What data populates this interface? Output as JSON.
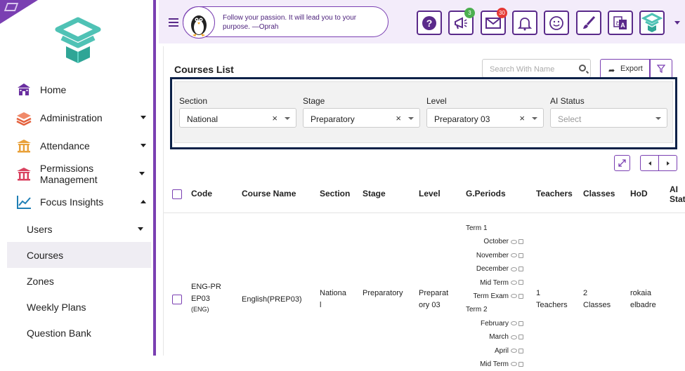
{
  "colors": {
    "accent": "#7a3fb2",
    "topbar": "#f3ecfa",
    "panel_border": "#0b2148",
    "badge_green": "#4caf50",
    "badge_red": "#e53935"
  },
  "sidebar": {
    "items": [
      {
        "label": "Home",
        "icon": "home-icon"
      },
      {
        "label": "Administration",
        "icon": "layers-icon"
      },
      {
        "label": "Attendance",
        "icon": "building-icon"
      },
      {
        "label": "Permissions Management",
        "icon": "building-icon"
      },
      {
        "label": "Focus Insights",
        "icon": "chart-line-icon"
      }
    ],
    "sub_items": [
      {
        "label": "Users"
      },
      {
        "label": "Courses"
      },
      {
        "label": "Zones"
      },
      {
        "label": "Weekly Plans"
      },
      {
        "label": "Question Bank"
      }
    ]
  },
  "topbar": {
    "quote": "Follow your passion. It will lead you to your purpose. —Oprah",
    "icons": [
      "help-icon",
      "megaphone-icon",
      "mail-icon",
      "bell-icon",
      "smiley-icon",
      "brush-icon",
      "translate-icon",
      "profile-logo-icon"
    ],
    "badges": {
      "announcements": "3",
      "messages": "30"
    }
  },
  "main": {
    "title": "Courses List",
    "search_placeholder": "Search With Name",
    "export_label": "Export",
    "filters": [
      {
        "label": "Section",
        "value": "National"
      },
      {
        "label": "Stage",
        "value": "Preparatory"
      },
      {
        "label": "Level",
        "value": "Preparatory 03"
      },
      {
        "label": "AI Status",
        "placeholder": "Select"
      }
    ],
    "table": {
      "headers": [
        "Code",
        "Course Name",
        "Section",
        "Stage",
        "Level",
        "G.Periods",
        "Teachers",
        "Classes",
        "HoD",
        "AI Stat"
      ],
      "row": {
        "code": "ENG-PREP03",
        "code_sub": "(ENG)",
        "course_name": "English(PREP03)",
        "section": "National",
        "stage": "Preparatory",
        "level": "Preparatory 03",
        "teachers": "1 Teachers",
        "classes": "2 Classes",
        "hod": "rokaia elbadre",
        "periods": [
          {
            "type": "term",
            "label": "Term 1"
          },
          {
            "type": "month",
            "label": "October"
          },
          {
            "type": "month",
            "label": "November"
          },
          {
            "type": "month",
            "label": "December"
          },
          {
            "type": "month",
            "label": "Mid Term"
          },
          {
            "type": "month",
            "label": "Term Exam"
          },
          {
            "type": "term",
            "label": "Term 2"
          },
          {
            "type": "month",
            "label": "February"
          },
          {
            "type": "month",
            "label": "March"
          },
          {
            "type": "month",
            "label": "April"
          },
          {
            "type": "month",
            "label": "Mid Term"
          }
        ]
      }
    }
  }
}
